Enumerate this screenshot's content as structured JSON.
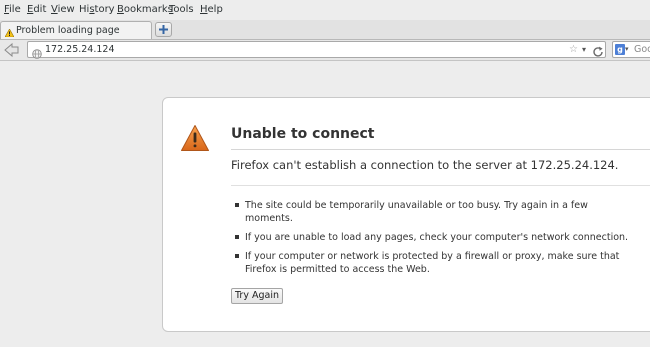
{
  "menu": [
    {
      "pre": "",
      "key": "F",
      "post": "ile"
    },
    {
      "pre": "",
      "key": "E",
      "post": "dit"
    },
    {
      "pre": "",
      "key": "V",
      "post": "iew"
    },
    {
      "pre": "Hi",
      "key": "s",
      "post": "tory"
    },
    {
      "pre": "",
      "key": "B",
      "post": "ookmarks"
    },
    {
      "pre": "",
      "key": "T",
      "post": "ools"
    },
    {
      "pre": "",
      "key": "H",
      "post": "elp"
    }
  ],
  "tab": {
    "title": "Problem loading page"
  },
  "navbar": {
    "url": "172.25.24.124",
    "search_engine": "Goo"
  },
  "error": {
    "title": "Unable to connect",
    "description": "Firefox can't establish a connection to the server at 172.25.24.124.",
    "bullets": [
      "The site could be temporarily unavailable or too busy. Try again in a few moments.",
      "If you are unable to load any pages, check your computer's network connection.",
      "If your computer or network is protected by a firewall or proxy, make sure that Firefox is permitted to access the Web."
    ],
    "button": "Try Again"
  },
  "colors": {
    "warning": "#e07a24",
    "search_brand": "#4d7fd6"
  }
}
